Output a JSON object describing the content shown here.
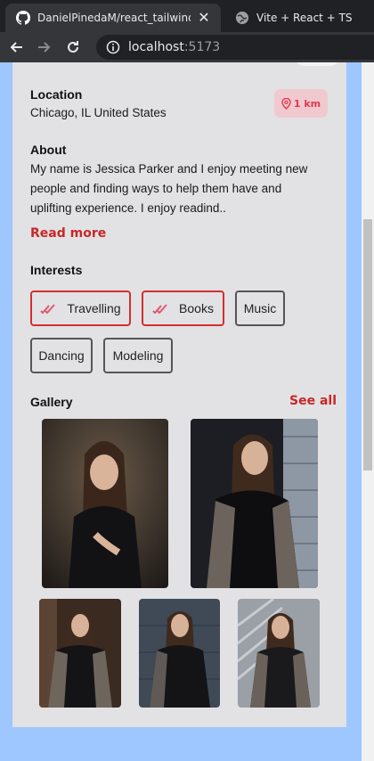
{
  "browser": {
    "tabs": [
      {
        "title": "DanielPinedaM/react_tailwind_ca",
        "icon": "github-icon",
        "active": true
      },
      {
        "title": "Vite + React + TS",
        "icon": "globe-icon",
        "active": false
      }
    ],
    "address": {
      "host": "localhost",
      "port": ":5173"
    }
  },
  "profile": {
    "location_heading": "Location",
    "location_value": "Chicago, IL United States",
    "distance": "1 km",
    "about_heading": "About",
    "about_text": "My name is Jessica Parker and I enjoy meeting new people and finding ways to help them have and uplifting experience. I enjoy readind..",
    "read_more": "Read more",
    "interests_heading": "Interests",
    "interests": [
      {
        "label": "Travelling",
        "selected": true
      },
      {
        "label": "Books",
        "selected": true
      },
      {
        "label": "Music",
        "selected": false
      },
      {
        "label": "Dancing",
        "selected": false
      },
      {
        "label": "Modeling",
        "selected": false
      }
    ],
    "gallery_heading": "Gallery",
    "see_all": "See all"
  },
  "colors": {
    "accent": "#c62828",
    "chip_selected_border": "#d32f2f",
    "card_bg": "#e2e1e4",
    "page_bg": "#9ec6ff"
  }
}
